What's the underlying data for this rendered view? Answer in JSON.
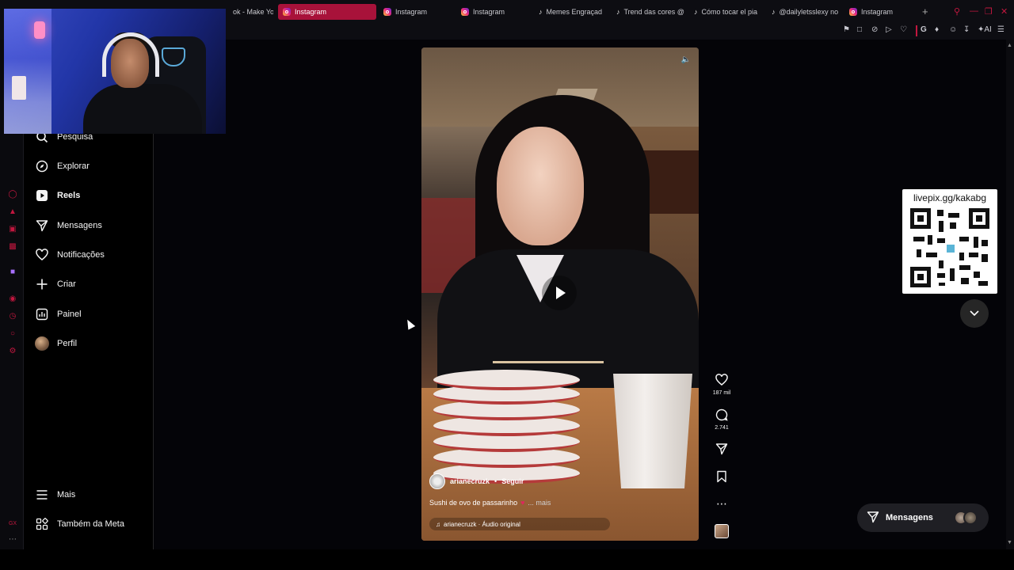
{
  "browser": {
    "tabs": [
      {
        "title": "ok - Make You",
        "icon": "tiktok-icon",
        "active": false
      },
      {
        "title": "Instagram",
        "icon": "instagram-icon",
        "active": true
      },
      {
        "title": "Instagram",
        "icon": "instagram-icon",
        "active": false
      },
      {
        "title": "Instagram",
        "icon": "instagram-icon",
        "active": false
      },
      {
        "title": "Memes Engraçad",
        "icon": "tiktok-icon",
        "active": false
      },
      {
        "title": "Trend das cores @",
        "icon": "tiktok-icon",
        "active": false
      },
      {
        "title": "Cómo tocar el pia",
        "icon": "tiktok-icon",
        "active": false
      },
      {
        "title": "@dailyletsslexy no",
        "icon": "tiktok-icon",
        "active": false
      },
      {
        "title": "Instagram",
        "icon": "instagram-icon",
        "active": false
      }
    ],
    "new_tab": "+",
    "ai_label": "AI",
    "accent": "#c2173f",
    "active_tab_color": "#a8123a"
  },
  "nav": {
    "items": [
      {
        "label": "Pesquisa",
        "icon": "search-icon"
      },
      {
        "label": "Explorar",
        "icon": "compass-icon"
      },
      {
        "label": "Reels",
        "icon": "reels-icon"
      },
      {
        "label": "Mensagens",
        "icon": "send-icon"
      },
      {
        "label": "Notificações",
        "icon": "heart-icon"
      },
      {
        "label": "Criar",
        "icon": "plus-icon"
      },
      {
        "label": "Painel",
        "icon": "chart-icon"
      },
      {
        "label": "Perfil",
        "icon": "avatar"
      }
    ],
    "more": {
      "label": "Mais",
      "icon": "menu-icon"
    },
    "also_meta": {
      "label": "Também da Meta",
      "icon": "meta-grid-icon"
    }
  },
  "reel": {
    "author": "arianecruzk",
    "separator": "•",
    "follow_label": "Seguir",
    "caption": "Sushi de ovo de passarinho",
    "caption_emoji": "♥",
    "more_label": "... mais",
    "audio": "arianecruzk · Áudio original"
  },
  "actions": {
    "likes": "187 mil",
    "comments": "2.741"
  },
  "overlay": {
    "qr_label": "livepix.gg/kakabg"
  },
  "messages_pill": {
    "label": "Mensagens"
  }
}
